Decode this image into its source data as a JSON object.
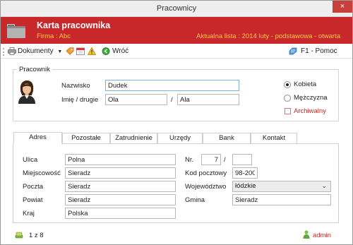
{
  "window": {
    "title": "Pracownicy",
    "close_glyph": "×"
  },
  "banner": {
    "heading": "Karta pracownika",
    "firm": "Firma : Abc",
    "list": "Aktualna lista : 2014 luty - podstawowa - otwarta",
    "icon": "folder-icon"
  },
  "toolbar": {
    "documents": "Dokumenty",
    "back": "Wróć",
    "help": "F1 - Pomoc",
    "icons": [
      "printer-icon",
      "tag-icon",
      "calendar-icon",
      "warning-icon",
      "back-icon",
      "help-icon"
    ]
  },
  "employee": {
    "section_label": "Pracownik",
    "surname_label": "Nazwisko",
    "surname_value": "Dudek",
    "first_names_label": "Imię / drugie",
    "first_name_value": "Ola",
    "name_separator": "/",
    "second_name_value": "Ala",
    "gender_female": "Kobieta",
    "gender_male": "Mężczyzna",
    "gender_selected": "Kobieta",
    "archived_label": "Archiwalny",
    "archived_checked": false
  },
  "tabs": {
    "items": [
      "Adres",
      "Pozostałe",
      "Zatrudnienie",
      "Urzędy",
      "Bank",
      "Kontakt"
    ],
    "active": "Adres"
  },
  "address": {
    "street_label": "Ulica",
    "street_value": "Polna",
    "city_label": "Miejscowość",
    "city_value": "Sieradz",
    "post_label": "Poczta",
    "post_value": "Sieradz",
    "county_label": "Powiat",
    "county_value": "Sieradz",
    "country_label": "Kraj",
    "country_value": "Polska",
    "number_label": "Nr.",
    "number_value": "7",
    "number_separator": "/",
    "flat_value": "",
    "postcode_label": "Kod pocztowy",
    "postcode_value": "98-200",
    "voivodeship_label": "Województwo",
    "voivodeship_value": "łódzkie",
    "commune_label": "Gmina",
    "commune_value": "Sieradz"
  },
  "status": {
    "record": "1 z 8",
    "user": "admin",
    "user_color": "#c9282b"
  },
  "colors": {
    "banner": "#c9282b",
    "banner_text": "#f6c94a",
    "close_button": "#c9403a",
    "archived_text": "#c9282b"
  }
}
